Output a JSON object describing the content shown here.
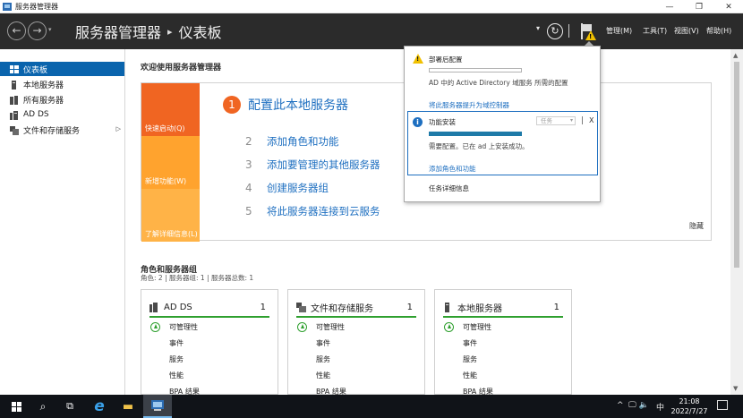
{
  "window": {
    "title": "服务器管理器",
    "minimize": "—",
    "maximize": "❐",
    "close": "✕"
  },
  "header": {
    "breadcrumb_root": "服务器管理器",
    "breadcrumb_sep": "▸",
    "breadcrumb_current": "仪表板",
    "back_icon": "←",
    "forward_icon": "→",
    "refresh_icon": "↻",
    "dropdown_icon": "▾",
    "menus": [
      "管理(M)",
      "工具(T)",
      "视图(V)",
      "帮助(H)"
    ]
  },
  "sidebar": {
    "items": [
      {
        "label": "仪表板",
        "active": true
      },
      {
        "label": "本地服务器",
        "active": false
      },
      {
        "label": "所有服务器",
        "active": false
      },
      {
        "label": "AD DS",
        "active": false
      },
      {
        "label": "文件和存储服务",
        "active": false,
        "expand": "▷"
      }
    ]
  },
  "welcome": {
    "title": "欢迎使用服务器管理器",
    "tiles": [
      "快速启动(Q)",
      "新增功能(W)",
      "了解详细信息(L)"
    ],
    "steps": [
      {
        "num": "1",
        "label": "配置此本地服务器"
      },
      {
        "num": "2",
        "label": "添加角色和功能"
      },
      {
        "num": "3",
        "label": "添加要管理的其他服务器"
      },
      {
        "num": "4",
        "label": "创建服务器组"
      },
      {
        "num": "5",
        "label": "将此服务器连接到云服务"
      }
    ],
    "hide": "隐藏"
  },
  "roles": {
    "title": "角色和服务器组",
    "subtitle": "角色: 2 | 服务器组: 1 | 服务器总数: 1",
    "cards": [
      {
        "name": "AD DS",
        "count": "1",
        "rows": [
          "可管理性",
          "事件",
          "服务",
          "性能",
          "BPA 结果"
        ]
      },
      {
        "name": "文件和存储服务",
        "count": "1",
        "rows": [
          "可管理性",
          "事件",
          "服务",
          "性能",
          "BPA 结果"
        ]
      },
      {
        "name": "本地服务器",
        "count": "1",
        "rows": [
          "可管理性",
          "事件",
          "服务",
          "性能",
          "BPA 结果"
        ]
      }
    ]
  },
  "popup": {
    "post_deploy_title": "部署后配置",
    "post_deploy_desc": "AD 中的 Active Directory 域服务 所需的配置",
    "promote_link": "将此服务器提升为域控制器",
    "feature_title": "功能安装",
    "task_select": "任务",
    "close": "X",
    "pipe": "|",
    "feature_desc": "需要配置。已在 ad 上安装成功。",
    "add_link": "添加角色和功能",
    "task_details": "任务详细信息",
    "info_icon": "i",
    "warn_icon": "!"
  },
  "taskbar": {
    "search_icon": "⌕",
    "taskview_icon": "⧉",
    "ie_icon": "e",
    "folder_icon": "▬",
    "tray_chevron": "^",
    "tray_icons": "🖵 🔈",
    "ime": "中",
    "time": "21:08",
    "date": "2022/7/27"
  },
  "colors": {
    "accent": "#0a64ad",
    "link": "#1e6fc0",
    "orange": "#f06522",
    "ok_green": "#2fa02f",
    "warning": "#f0c000"
  }
}
